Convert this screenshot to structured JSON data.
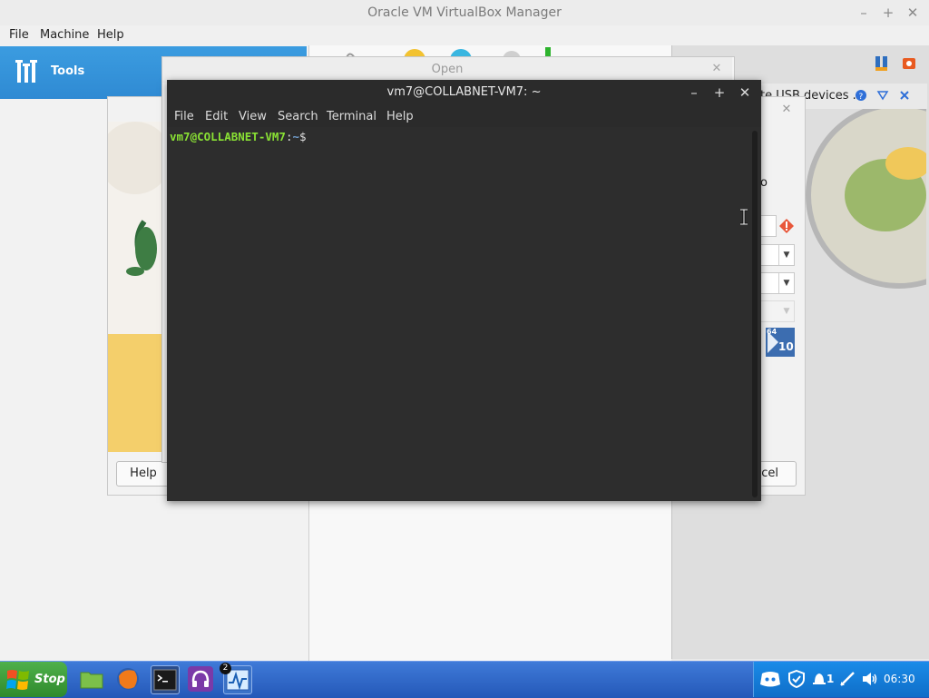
{
  "vbox": {
    "title": "Oracle VM VirtualBox Manager",
    "win_min": "–",
    "win_max": "+",
    "win_close": "✕",
    "menu": [
      "File",
      "Machine",
      "Help"
    ],
    "tools_label": "Tools",
    "notification": "te USB devices ..."
  },
  "wizard": {
    "help_label": "Help",
    "cancel_label": "ncel",
    "close": "✕",
    "partial_text": "o",
    "os_badge_bits": "64",
    "os_badge_version": "10"
  },
  "open_dialog": {
    "title": "Open",
    "close": "✕"
  },
  "terminal": {
    "title": "vm7@COLLABNET-VM7: ~",
    "win_min": "–",
    "win_max": "+",
    "win_close": "✕",
    "menu": [
      "File",
      "Edit",
      "View",
      "Search",
      "Terminal",
      "Help"
    ],
    "prompt_user": "vm7@COLLABNET-VM7",
    "prompt_sep": ":",
    "prompt_path": "~",
    "prompt_symbol": "$"
  },
  "taskbar": {
    "start_label": "Stop",
    "badge_count": "2",
    "tray_count": "1",
    "clock": "06:30"
  }
}
